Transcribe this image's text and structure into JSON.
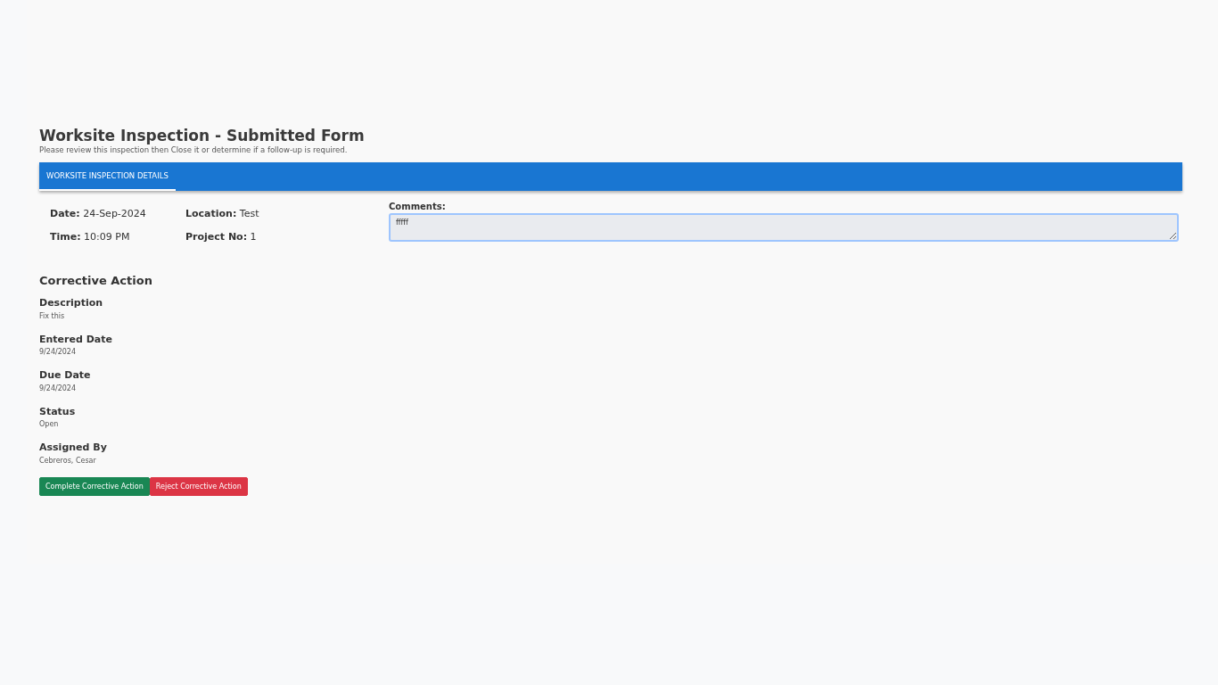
{
  "page": {
    "title": "Worksite Inspection - Submitted Form",
    "subtitle": "Please review this inspection then Close it or determine if a follow-up is required."
  },
  "tabs": [
    {
      "label": "WORKSITE INSPECTION DETAILS",
      "selected": true
    }
  ],
  "details": [
    {
      "label": "Date:",
      "value": "24-Sep-2024"
    },
    {
      "label": "Location:",
      "value": "Test"
    },
    {
      "label": "Time:",
      "value": "10:09 PM"
    },
    {
      "label": "Project No:",
      "value": "1"
    }
  ],
  "comments": {
    "label": "Comments:",
    "value": "fffff"
  },
  "corrective_action": {
    "title": "Corrective Action",
    "fields": [
      {
        "label": "Description",
        "value": "Fix this"
      },
      {
        "label": "Entered Date",
        "value": "9/24/2024"
      },
      {
        "label": "Due Date",
        "value": "9/24/2024"
      },
      {
        "label": "Status",
        "value": "Open"
      },
      {
        "label": "Assigned By",
        "value": "Cebreros, Cesar"
      }
    ],
    "buttons": [
      {
        "label": "Complete Corrective Action",
        "kind": "success"
      },
      {
        "label": "Reject Corrective Action",
        "kind": "danger"
      }
    ]
  }
}
